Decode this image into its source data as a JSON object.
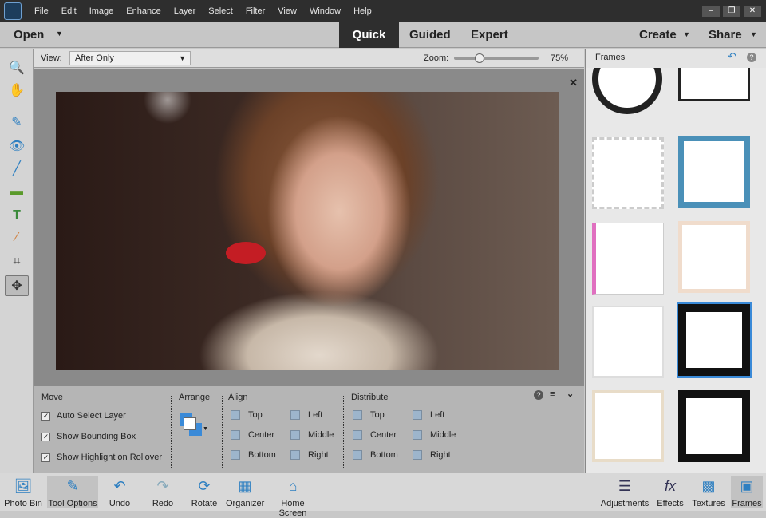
{
  "menu": [
    "File",
    "Edit",
    "Image",
    "Enhance",
    "Layer",
    "Select",
    "Filter",
    "View",
    "Window",
    "Help"
  ],
  "modebar": {
    "open": "Open",
    "tabs": [
      "Quick",
      "Guided",
      "Expert"
    ],
    "create": "Create",
    "share": "Share"
  },
  "viewbar": {
    "view_label": "View:",
    "view_value": "After Only",
    "zoom_label": "Zoom:",
    "zoom_value": "75%",
    "zoom_fraction": 0.2
  },
  "panel": {
    "title": "Frames"
  },
  "tool_options": {
    "move": {
      "title": "Move",
      "options": [
        "Auto Select Layer",
        "Show Bounding Box",
        "Show Highlight on Rollover"
      ]
    },
    "arrange": {
      "title": "Arrange"
    },
    "align": {
      "title": "Align",
      "col1": [
        "Top",
        "Center",
        "Bottom"
      ],
      "col2": [
        "Left",
        "Middle",
        "Right"
      ]
    },
    "distribute": {
      "title": "Distribute",
      "col1": [
        "Top",
        "Center",
        "Bottom"
      ],
      "col2": [
        "Left",
        "Middle",
        "Right"
      ]
    }
  },
  "bottom_left": [
    "Photo Bin",
    "Tool Options",
    "Undo",
    "Redo",
    "Rotate",
    "Organizer",
    "Home Screen"
  ],
  "bottom_right": [
    "Adjustments",
    "Effects",
    "Textures",
    "Frames"
  ]
}
